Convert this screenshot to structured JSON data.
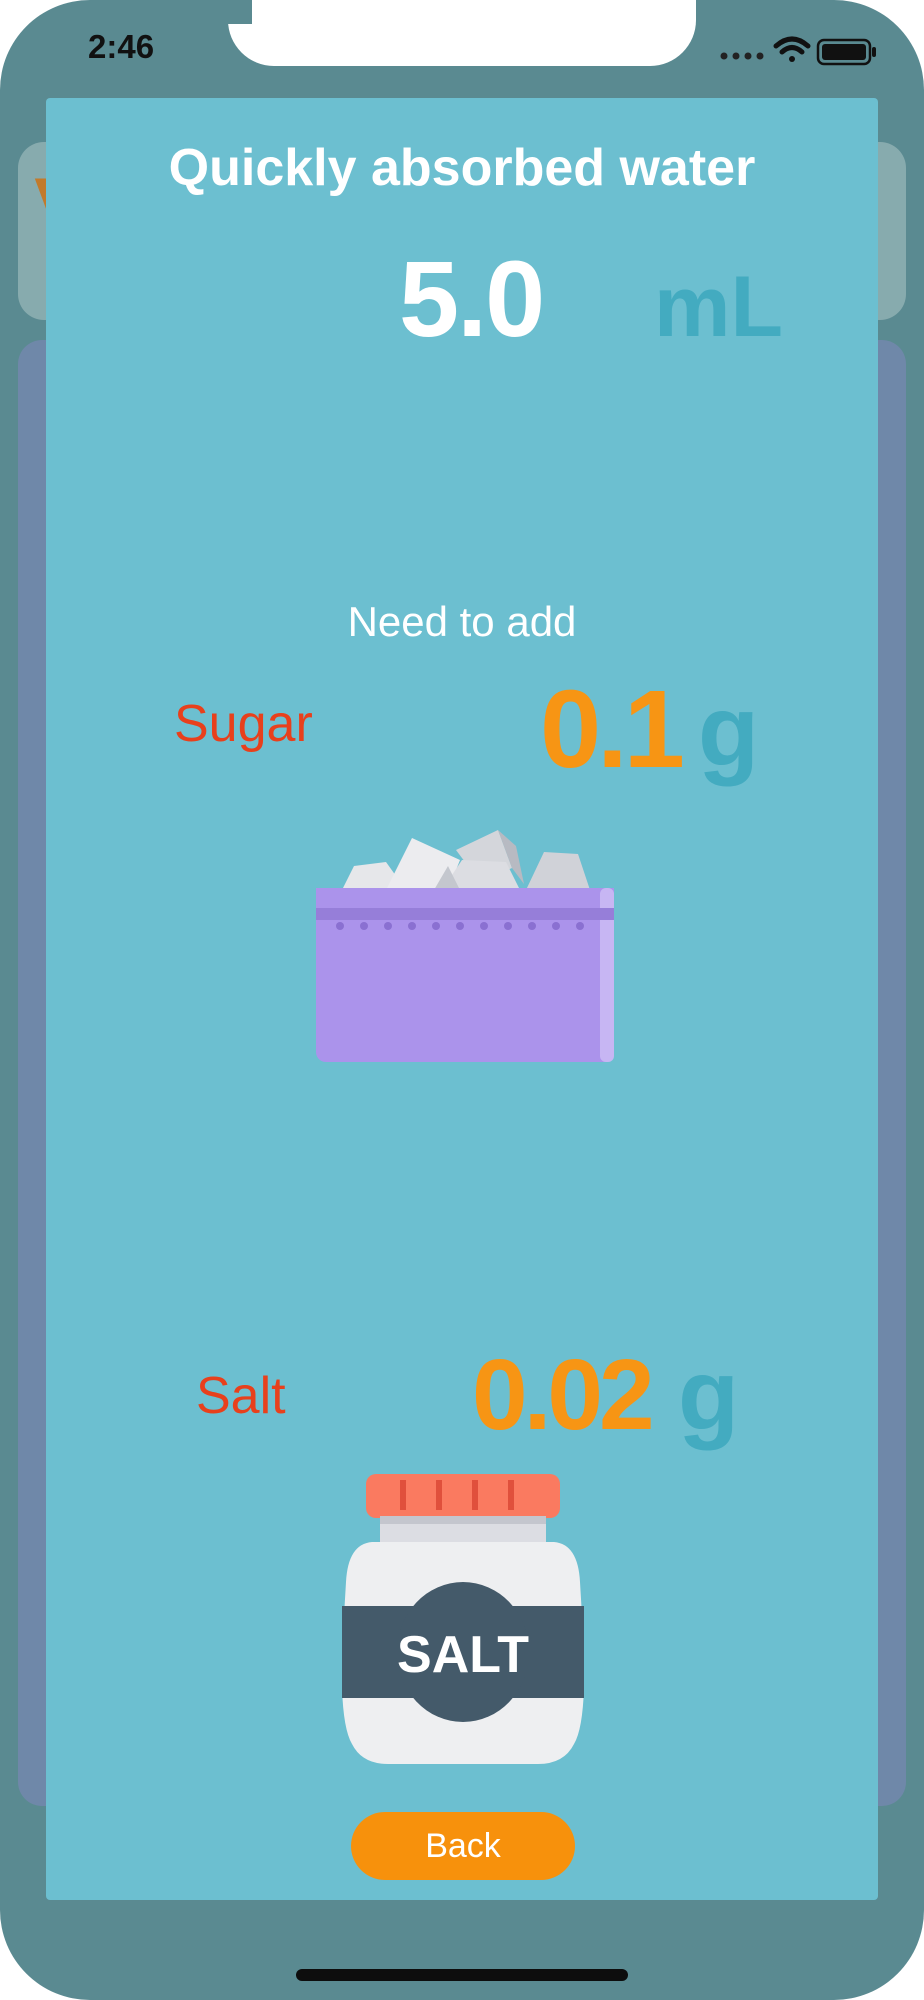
{
  "status": {
    "time": "2:46"
  },
  "background": {
    "card_glyph": "V"
  },
  "modal": {
    "title": "Quickly absorbed water",
    "volume_value": "5.0",
    "volume_unit": "mL",
    "need_label": "Need to add",
    "sugar": {
      "label": "Sugar",
      "amount": "0.1",
      "unit": "g",
      "icon": "sugar-bowl-icon"
    },
    "salt": {
      "label": "Salt",
      "amount": "0.02",
      "unit": "g",
      "jar_text": "SALT",
      "icon": "salt-jar-icon"
    },
    "back_label": "Back"
  },
  "colors": {
    "modal_bg": "#6cbfd0",
    "accent_orange": "#f79514",
    "unit_teal": "#43abc0",
    "label_red": "#e8401c"
  }
}
